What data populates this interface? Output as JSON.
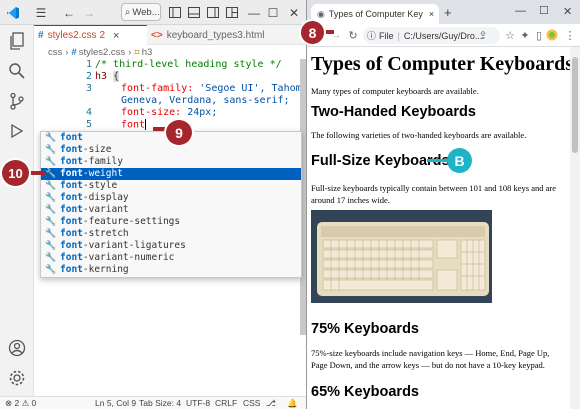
{
  "vscode": {
    "search_text": "Web...",
    "tabs": [
      {
        "label": "styles2.css",
        "badge": "2",
        "close": "×"
      },
      {
        "label": "keyboard_types3.html"
      }
    ],
    "breadcrumb": {
      "folder": "css",
      "file": "styles2.css",
      "symbol": "h3"
    },
    "lines": [
      {
        "n": "1",
        "comment": "/* third-level heading style */"
      },
      {
        "n": "2",
        "selector": "h3",
        "brace": "{"
      },
      {
        "n": "3",
        "prop": "font-family:",
        "value": "'Segoe UI', Tahoma,"
      },
      {
        "n": "",
        "value": "Geneva, Verdana, sans-serif;"
      },
      {
        "n": "4",
        "prop": "font-size:",
        "value": "24px;"
      },
      {
        "n": "5",
        "prop": "font"
      }
    ],
    "suggestions": [
      {
        "match": "font",
        "rest": ""
      },
      {
        "match": "font",
        "rest": "-size"
      },
      {
        "match": "font",
        "rest": "-family"
      },
      {
        "match": "font",
        "rest": "-weight"
      },
      {
        "match": "font",
        "rest": "-style"
      },
      {
        "match": "font",
        "rest": "-display"
      },
      {
        "match": "font",
        "rest": "-variant"
      },
      {
        "match": "font",
        "rest": "-feature-settings"
      },
      {
        "match": "font",
        "rest": "-stretch"
      },
      {
        "match": "font",
        "rest": "-variant-ligatures"
      },
      {
        "match": "font",
        "rest": "-variant-numeric"
      },
      {
        "match": "font",
        "rest": "-kerning"
      }
    ],
    "status": {
      "errors": "⊗ 2 ⚠ 0",
      "position": "Ln 5, Col 9",
      "tabsize": "Tab Size: 4",
      "encoding": "UTF-8",
      "eol": "CRLF",
      "language": "CSS"
    }
  },
  "browser": {
    "tab_title": "Types of Computer Keyboards",
    "tab_close": "×",
    "new_tab": "+",
    "url_prefix": "File",
    "url": "C:/Users/Guy/Dro...",
    "page": {
      "h1": "Types of Computer Keyboards",
      "p1": "Many types of computer keyboards are available.",
      "h2_two_handed": "Two-Handed Keyboards",
      "p2": "The following varieties of two-handed keyboards are available.",
      "h3_full_size": "Full-Size Keyboards",
      "p3": "Full-size keyboards typically contain between 101 and 108 keys and are around 17 inches wide.",
      "h3_75": "75% Keyboards",
      "p4": "75%-size keyboards include navigation keys — Home, End, Page Up, Page Down, and the arrow keys — but do not have a 10-key keypad.",
      "h3_65": "65% Keyboards"
    }
  },
  "callouts": {
    "c8": "8",
    "c9": "9",
    "c10": "10",
    "cB": "B"
  },
  "colors": {
    "callout": "#a5262c",
    "calloutB": "#1fb3c8",
    "accent": "#0060c0"
  }
}
